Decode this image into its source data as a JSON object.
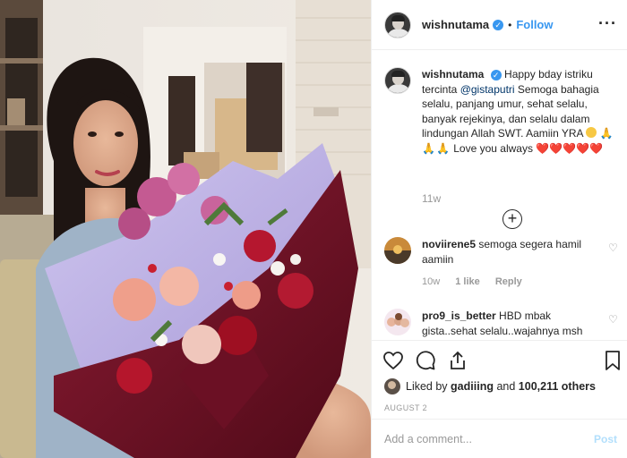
{
  "header": {
    "username": "wishnutama",
    "verified_glyph": "✓",
    "separator": "•",
    "follow_label": "Follow",
    "more_label": "···"
  },
  "caption": {
    "username": "wishnutama",
    "text_1": "Happy bday istriku tercinta",
    "mention": "@gistaputri",
    "text_2": "Semoga bahagia selalu, panjang umur, sehat selalu, banyak rejekinya, dan selalu dalam lindungan Allah SWT. Aamiin YRA",
    "pray_emojis": "🙏🙏🙏",
    "text_3": "Love you always",
    "hearts": "❤️❤️❤️❤️❤️",
    "time": "11w",
    "load_more": "+"
  },
  "comments": [
    {
      "username": "noviirene5",
      "text": "semoga segera hamil aamiin",
      "time": "10w",
      "likes": "1 like",
      "reply": "Reply"
    },
    {
      "username": "pro9_is_better",
      "text": "HBD mbak gista..sehat selalu..wajahnya msh",
      "time": "",
      "likes": "",
      "reply": ""
    }
  ],
  "actions": {
    "icons": [
      "heart-icon",
      "comment-icon",
      "share-icon",
      "bookmark-icon"
    ]
  },
  "likes": {
    "prefix": "Liked by",
    "first_user": "gadiiing",
    "and": "and",
    "others": "100,211 others"
  },
  "date": "AUGUST 2",
  "add_comment": {
    "placeholder": "Add a comment...",
    "post_label": "Post"
  },
  "colors": {
    "link_blue": "#3897f0",
    "mention_navy": "#003569",
    "heart_red": "#e0245e",
    "muted_gray": "#999999",
    "divider": "#efefef"
  }
}
